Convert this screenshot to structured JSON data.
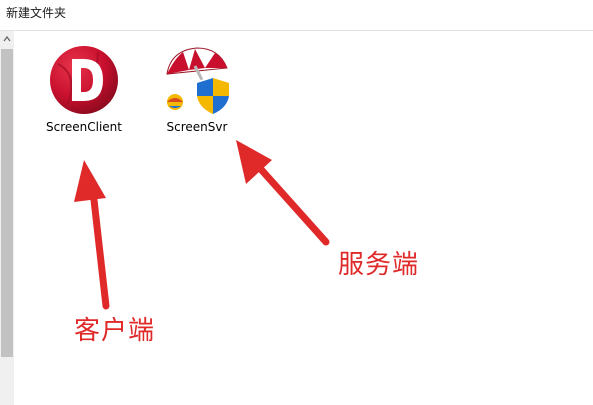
{
  "window": {
    "title": "新建文件夹"
  },
  "files": [
    {
      "name": "ScreenClient",
      "icon": "red-d-app-icon"
    },
    {
      "name": "ScreenSvr",
      "icon": "beach-umbrella-shield-icon"
    }
  ],
  "annotations": {
    "client_label": "客户端",
    "server_label": "服务端",
    "color": "#e02a2a"
  },
  "colors": {
    "icon_red": "#c8102e",
    "shield_blue": "#1f6fd1",
    "shield_yellow": "#f5b800"
  }
}
